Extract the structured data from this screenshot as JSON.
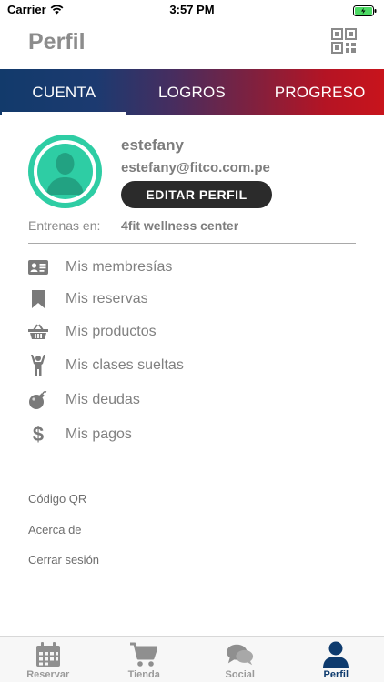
{
  "status_bar": {
    "carrier": "Carrier",
    "time": "3:57 PM"
  },
  "header": {
    "title": "Perfil",
    "qr_icon": "qr-code-icon"
  },
  "tabs": [
    {
      "label": "CUENTA",
      "active": true
    },
    {
      "label": "LOGROS",
      "active": false
    },
    {
      "label": "PROGRESO",
      "active": false
    }
  ],
  "profile": {
    "name": "estefany",
    "email": "estefany@fitco.com.pe",
    "edit_label": "EDITAR PERFIL",
    "avatar_color": "#2ecda4"
  },
  "gym": {
    "label": "Entrenas en:",
    "name": "4fit wellness center"
  },
  "menu": [
    {
      "label": "Mis membresías",
      "icon": "id-card-icon"
    },
    {
      "label": "Mis reservas",
      "icon": "bookmark-icon"
    },
    {
      "label": "Mis productos",
      "icon": "basket-icon"
    },
    {
      "label": "Mis clases sueltas",
      "icon": "person-raising-arms-icon"
    },
    {
      "label": "Mis deudas",
      "icon": "bomb-icon"
    },
    {
      "label": "Mis pagos",
      "icon": "dollar-icon"
    }
  ],
  "links": [
    {
      "label": "Código QR"
    },
    {
      "label": "Acerca de"
    },
    {
      "label": "Cerrar sesión"
    }
  ],
  "tabbar": [
    {
      "label": "Reservar",
      "icon": "calendar-icon",
      "active": false
    },
    {
      "label": "Tienda",
      "icon": "cart-icon",
      "active": false
    },
    {
      "label": "Social",
      "icon": "chat-bubbles-icon",
      "active": false
    },
    {
      "label": "Perfil",
      "icon": "user-icon",
      "active": true
    }
  ],
  "colors": {
    "accent": "#2ecda4",
    "tab_gradient_start": "#123a6b",
    "tab_gradient_end": "#c8141c",
    "active_tab": "#0e3b6e"
  }
}
